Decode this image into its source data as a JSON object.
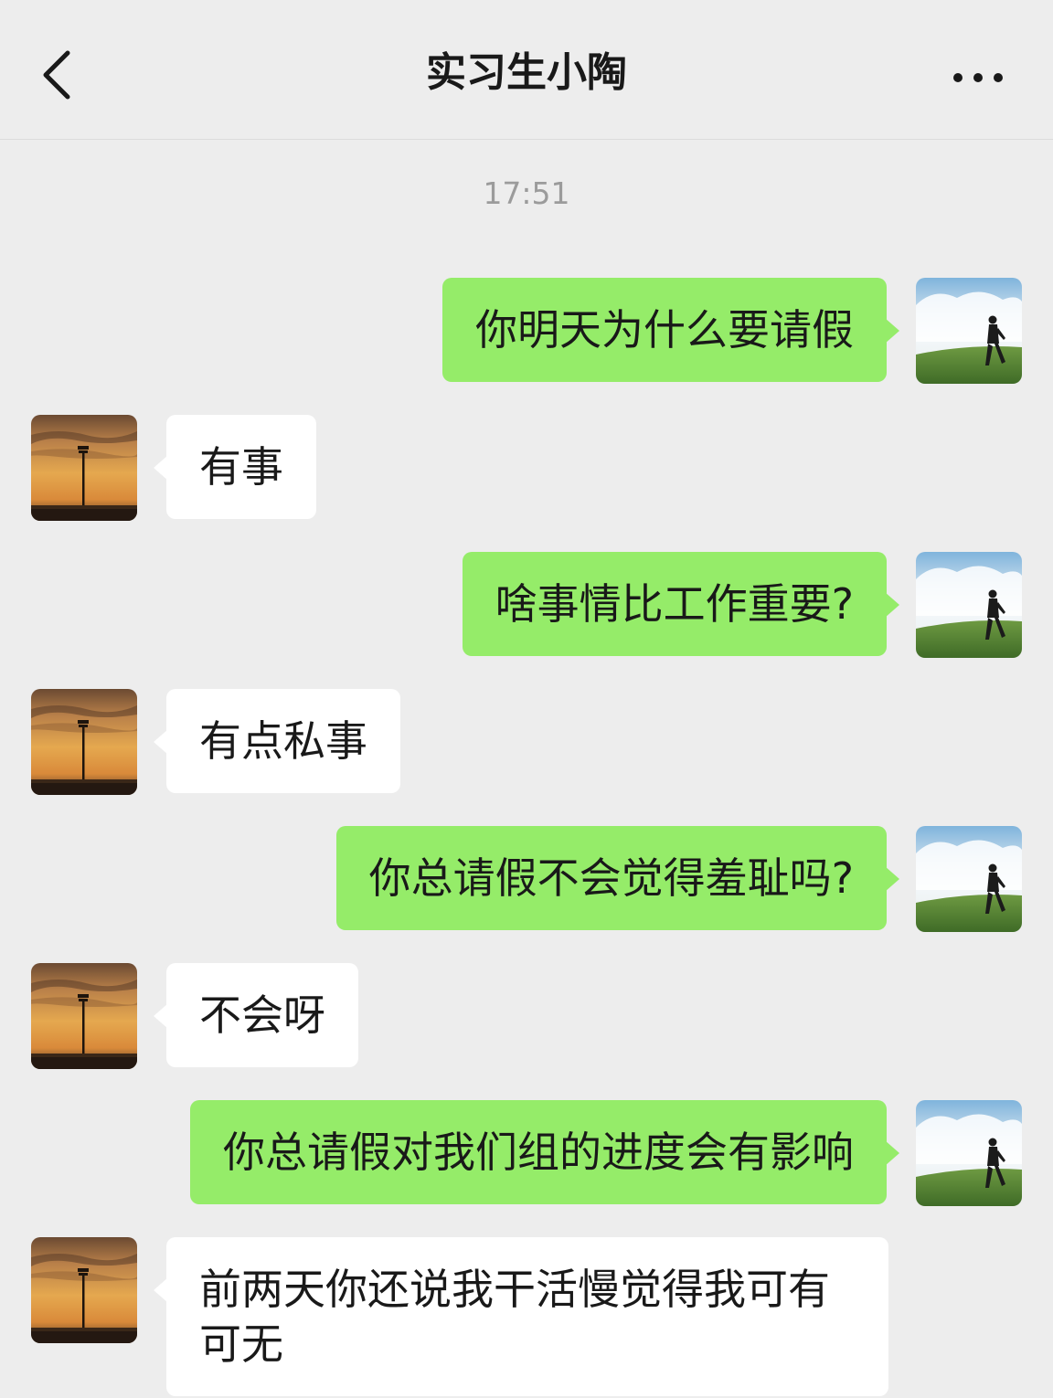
{
  "header": {
    "title": "实习生小陶",
    "back_icon": "chevron-left-icon",
    "more_icon": "more-horizontal-icon"
  },
  "timestamp": "17:51",
  "colors": {
    "background": "#ededed",
    "outgoing_bubble": "#95ec69",
    "incoming_bubble": "#ffffff",
    "text": "#191919",
    "timestamp": "#9b9b9b"
  },
  "messages": [
    {
      "direction": "out",
      "text": "你明天为什么要请假"
    },
    {
      "direction": "in",
      "text": "有事"
    },
    {
      "direction": "out",
      "text": "啥事情比工作重要?"
    },
    {
      "direction": "in",
      "text": "有点私事"
    },
    {
      "direction": "out",
      "text": "你总请假不会觉得羞耻吗?"
    },
    {
      "direction": "in",
      "text": "不会呀"
    },
    {
      "direction": "out",
      "text": "你总请假对我们组的进度会有影响"
    },
    {
      "direction": "in",
      "text": "前两天你还说我干活慢觉得我可有可无"
    }
  ],
  "avatars": {
    "me": "grass-field-avatar",
    "contact": "sunset-light-pole-avatar"
  }
}
